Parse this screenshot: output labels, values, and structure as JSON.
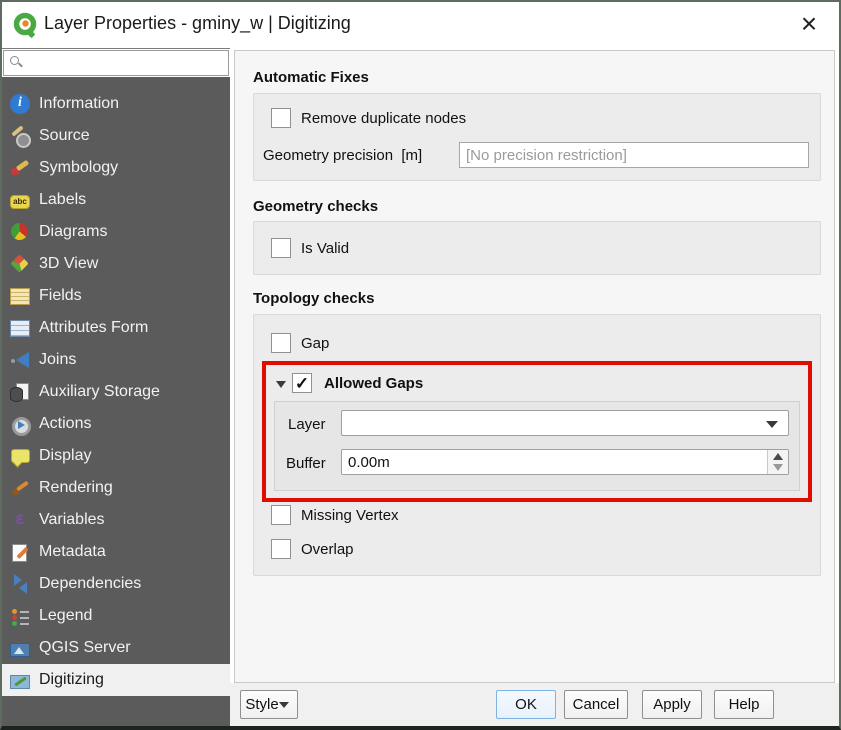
{
  "window": {
    "title": "Layer Properties - gminy_w | Digitizing",
    "close_glyph": "×"
  },
  "icons": {
    "checkmark": "✓"
  },
  "sidebar": {
    "search_value": "",
    "selected": "Digitizing",
    "items": [
      {
        "label": "Information",
        "icon": "information-icon"
      },
      {
        "label": "Source",
        "icon": "source-icon"
      },
      {
        "label": "Symbology",
        "icon": "symbology-icon"
      },
      {
        "label": "Labels",
        "icon": "labels-icon"
      },
      {
        "label": "Diagrams",
        "icon": "diagrams-icon"
      },
      {
        "label": "3D View",
        "icon": "3d-view-icon"
      },
      {
        "label": "Fields",
        "icon": "fields-icon"
      },
      {
        "label": "Attributes Form",
        "icon": "attributes-form-icon"
      },
      {
        "label": "Joins",
        "icon": "joins-icon"
      },
      {
        "label": "Auxiliary Storage",
        "icon": "auxiliary-storage-icon"
      },
      {
        "label": "Actions",
        "icon": "actions-icon"
      },
      {
        "label": "Display",
        "icon": "display-icon"
      },
      {
        "label": "Rendering",
        "icon": "rendering-icon"
      },
      {
        "label": "Variables",
        "icon": "variables-icon"
      },
      {
        "label": "Metadata",
        "icon": "metadata-icon"
      },
      {
        "label": "Dependencies",
        "icon": "dependencies-icon"
      },
      {
        "label": "Legend",
        "icon": "legend-icon"
      },
      {
        "label": "QGIS Server",
        "icon": "qgis-server-icon"
      },
      {
        "label": "Digitizing",
        "icon": "digitizing-icon"
      }
    ]
  },
  "main": {
    "automatic_fixes": {
      "title": "Automatic Fixes",
      "remove_duplicate_nodes_label": "Remove duplicate nodes",
      "remove_duplicate_nodes_checked": false,
      "geometry_precision_label": "Geometry precision  [m]",
      "geometry_precision_value": "",
      "geometry_precision_placeholder": "[No precision restriction]"
    },
    "geometry_checks": {
      "title": "Geometry checks",
      "is_valid_label": "Is Valid",
      "is_valid_checked": false
    },
    "topology_checks": {
      "title": "Topology checks",
      "gap_label": "Gap",
      "gap_checked": false,
      "allowed_gaps": {
        "label": "Allowed Gaps",
        "checked": true,
        "layer_label": "Layer",
        "layer_value": "",
        "buffer_label": "Buffer",
        "buffer_value": "0.00m"
      },
      "missing_vertex_label": "Missing Vertex",
      "missing_vertex_checked": false,
      "overlap_label": "Overlap",
      "overlap_checked": false
    }
  },
  "footer": {
    "style_label": "Style",
    "ok_label": "OK",
    "cancel_label": "Cancel",
    "apply_label": "Apply",
    "help_label": "Help"
  },
  "colors": {
    "sidebar_bg": "#5b5b5b",
    "highlight_red": "#e00e00",
    "default_button_blue": "#7fb2e5",
    "groupbox_bg": "#ececec"
  }
}
